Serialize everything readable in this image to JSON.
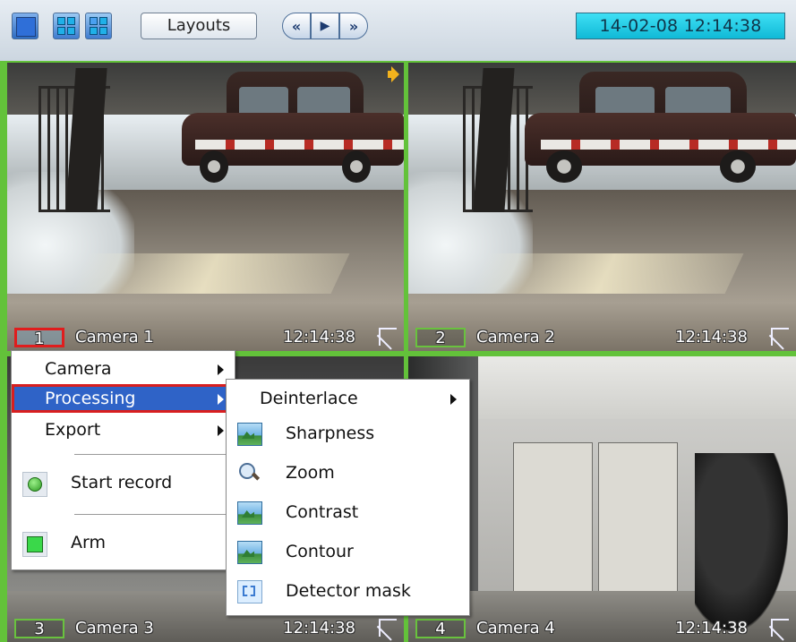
{
  "toolbar": {
    "layout_buttons": [
      "single-view",
      "quad-view",
      "mixed-view"
    ],
    "layouts_label": "Layouts",
    "nav": {
      "rewind_glyph": "«",
      "play_glyph": "▶",
      "forward_glyph": "»"
    },
    "datetime": "14-02-08   12:14:38"
  },
  "cameras": [
    {
      "number": "1",
      "name": "Camera 1",
      "time": "12:14:38",
      "selected": true
    },
    {
      "number": "2",
      "name": "Camera 2",
      "time": "12:14:38",
      "selected": false
    },
    {
      "number": "3",
      "name": "Camera 3",
      "time": "12:14:38",
      "selected": false
    },
    {
      "number": "4",
      "name": "Camera 4",
      "time": "12:14:38",
      "selected": false
    }
  ],
  "context_menu": {
    "items": [
      {
        "label": "Camera",
        "has_submenu": true
      },
      {
        "label": "Processing",
        "has_submenu": true,
        "highlighted": true
      },
      {
        "label": "Export",
        "has_submenu": true
      },
      {
        "label": "Start record",
        "icon": "record-icon"
      },
      {
        "label": "Arm",
        "icon": "arm-icon"
      }
    ]
  },
  "processing_submenu": {
    "items": [
      {
        "label": "Deinterlace",
        "has_submenu": true
      },
      {
        "label": "Sharpness",
        "icon": "sharpness-icon"
      },
      {
        "label": "Zoom",
        "icon": "zoom-icon"
      },
      {
        "label": "Contrast",
        "icon": "contrast-icon"
      },
      {
        "label": "Contour",
        "icon": "contour-icon"
      },
      {
        "label": "Detector mask",
        "icon": "detector-mask-icon"
      }
    ]
  },
  "colors": {
    "grid_border": "#63c23a",
    "datetime_bg": "#10b9d6",
    "highlight": "#2f63c7",
    "selection_outline": "#d81f1f"
  }
}
